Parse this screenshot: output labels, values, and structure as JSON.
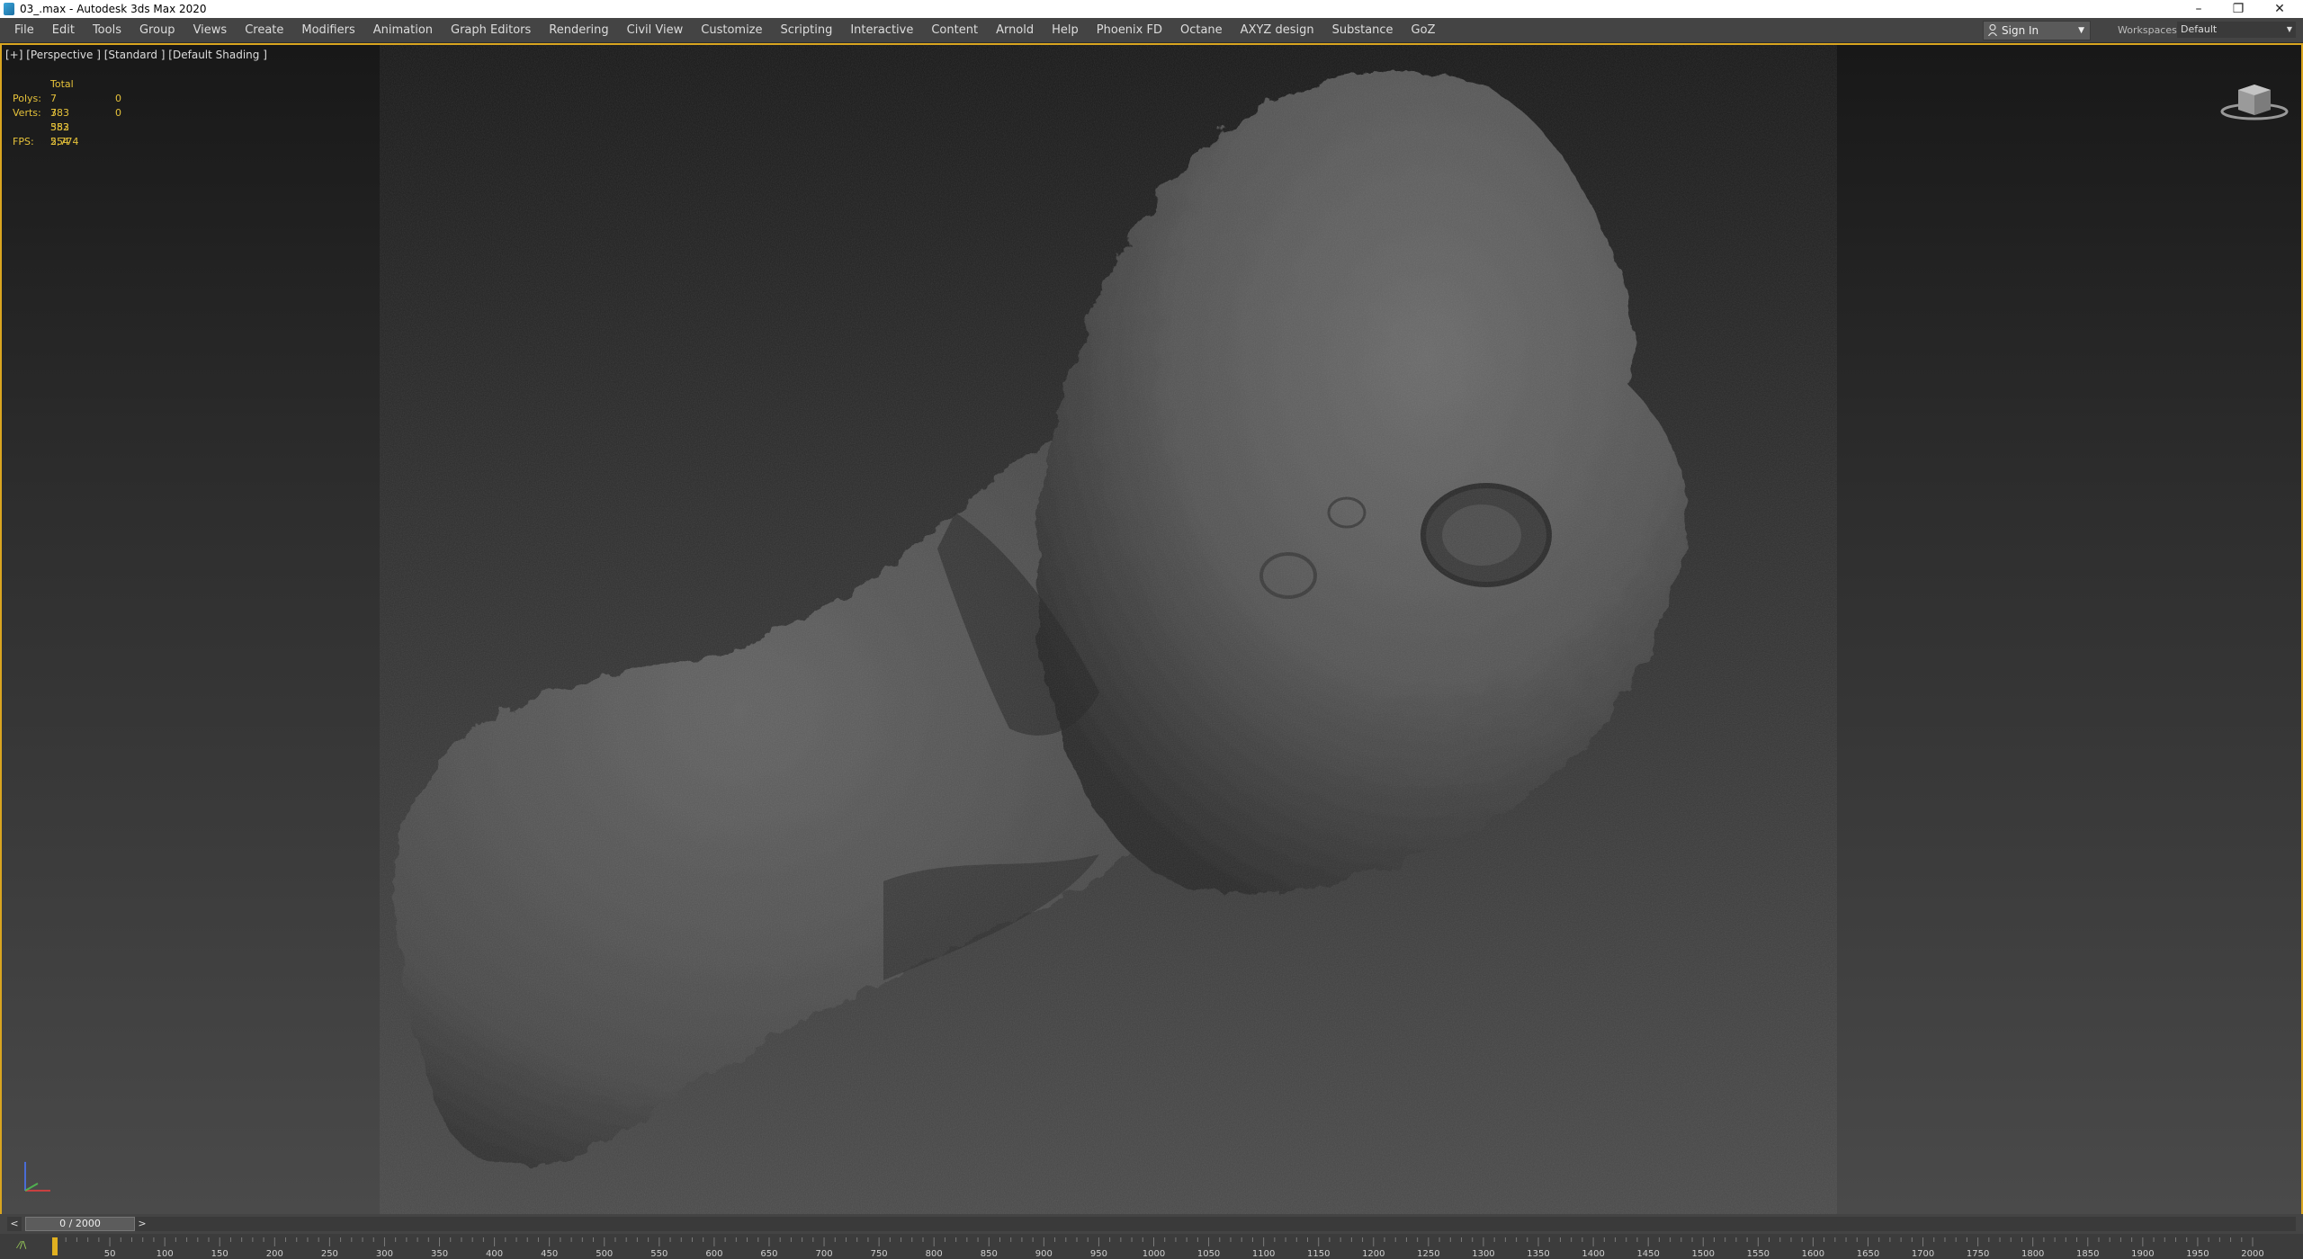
{
  "window": {
    "title": "03_.max - Autodesk 3ds Max 2020",
    "minimize": "–",
    "restore": "❐",
    "close": "✕"
  },
  "menu": {
    "items": [
      "File",
      "Edit",
      "Tools",
      "Group",
      "Views",
      "Create",
      "Modifiers",
      "Animation",
      "Graph Editors",
      "Rendering",
      "Civil View",
      "Customize",
      "Scripting",
      "Interactive",
      "Content",
      "Arnold",
      "Help",
      "Phoenix FD",
      "Octane",
      "AXYZ design",
      "Substance",
      "GoZ"
    ],
    "sign_in": "Sign In",
    "workspaces_label": "Workspaces:",
    "workspace_value": "Default"
  },
  "viewport": {
    "label": "[+] [Perspective ] [Standard ] [Default Shading ]",
    "stats": {
      "header": "Total",
      "polys_label": "Polys:",
      "polys_value": "7 383 552",
      "polys_sel": "0",
      "verts_label": "Verts:",
      "verts_value": "7 383 554",
      "verts_sel": "0",
      "fps_label": "FPS:",
      "fps_value": "2,774"
    },
    "border_color": "#d9a520",
    "stats_color": "#e6c23a"
  },
  "timeline": {
    "slider_text": "0 / 2000",
    "prev": "<",
    "next": ">",
    "track_icon": "⁄/\\",
    "current_frame": 0,
    "total_frames": 2000,
    "ruler_labels": [
      "50",
      "100",
      "150",
      "200",
      "250",
      "300",
      "350",
      "400",
      "450",
      "500",
      "550",
      "600",
      "650",
      "700",
      "750",
      "800",
      "850",
      "900",
      "950",
      "1000",
      "1050",
      "1100",
      "1150",
      "1200",
      "1250",
      "1300",
      "1350",
      "1400",
      "1450",
      "1500",
      "1550",
      "1600",
      "1650",
      "1700",
      "1750",
      "1800",
      "1850",
      "1900",
      "1950",
      "2000"
    ]
  }
}
